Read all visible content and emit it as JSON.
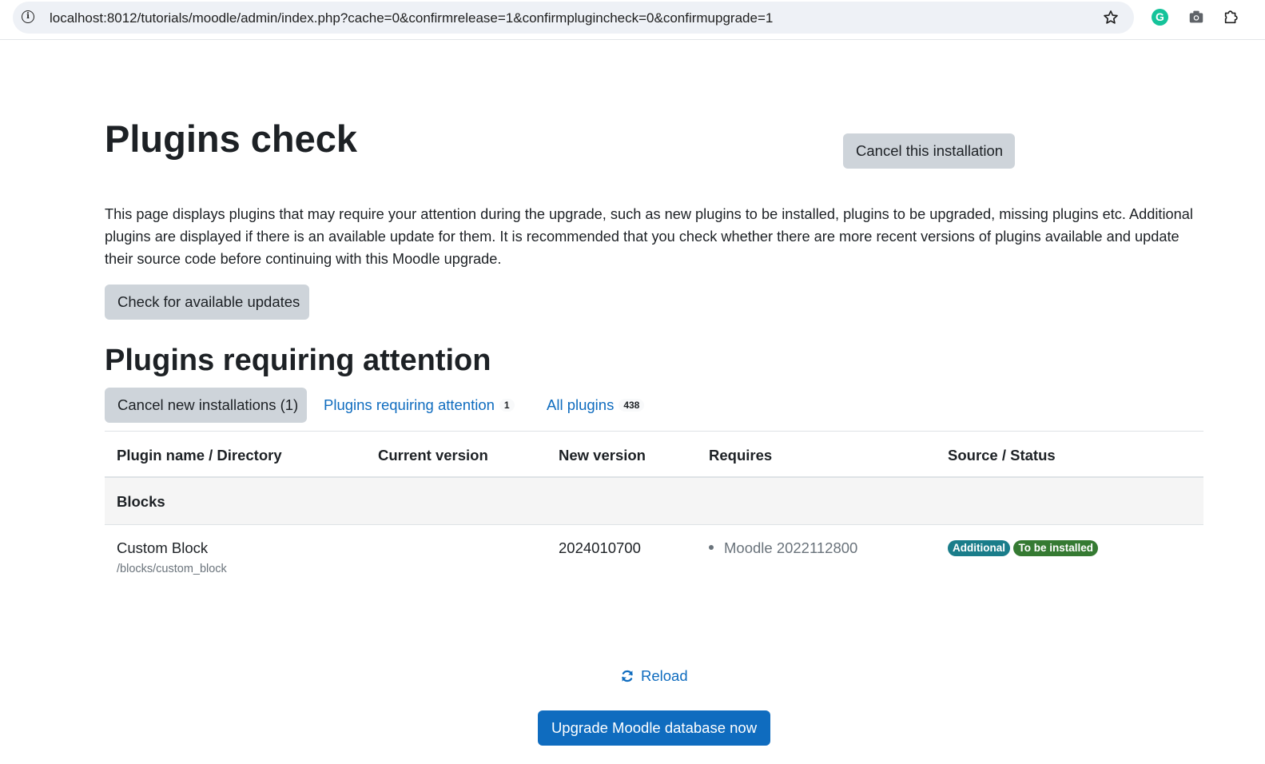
{
  "browser": {
    "url": "localhost:8012/tutorials/moodle/admin/index.php?cache=0&confirmrelease=1&confirmplugincheck=0&confirmupgrade=1",
    "info_icon": "i",
    "extension_icon": "G"
  },
  "page": {
    "title": "Plugins check",
    "intro": "This page displays plugins that may require your attention during the upgrade, such as new plugins to be installed, plugins to be upgraded, missing plugins etc. Additional plugins are displayed if there is an available update for them. It is recommended that you check whether there are more recent versions of plugins available and update their source code before continuing with this Moodle upgrade.",
    "check_updates_label": "Check for available updates"
  },
  "attention": {
    "heading": "Plugins requiring attention",
    "cancel_new_label": "Cancel new installations (1)",
    "filter_attention_label": "Plugins requiring attention",
    "filter_attention_count": "1",
    "filter_all_label": "All plugins",
    "filter_all_count": "438"
  },
  "table": {
    "headers": [
      "Plugin name / Directory",
      "Current version",
      "New version",
      "Requires",
      "Source / Status"
    ],
    "groups": [
      {
        "name": "Blocks",
        "plugins": [
          {
            "name": "Custom Block",
            "directory": "/blocks/custom_block",
            "current_version": "",
            "new_version": "2024010700",
            "requires": "Moodle 2022112800",
            "badges": [
              {
                "label": "Additional",
                "color": "#1a7d8a"
              },
              {
                "label": "To be installed",
                "color": "#357a32"
              }
            ],
            "action_label": "Cancel this installation"
          }
        ]
      }
    ]
  },
  "footer": {
    "reload_label": "Reload",
    "upgrade_label": "Upgrade Moodle database now"
  },
  "colors": {
    "primary": "#0f6cbf",
    "secondary_button": "#ced4da",
    "text": "#1d2125",
    "muted": "#6a737b"
  }
}
